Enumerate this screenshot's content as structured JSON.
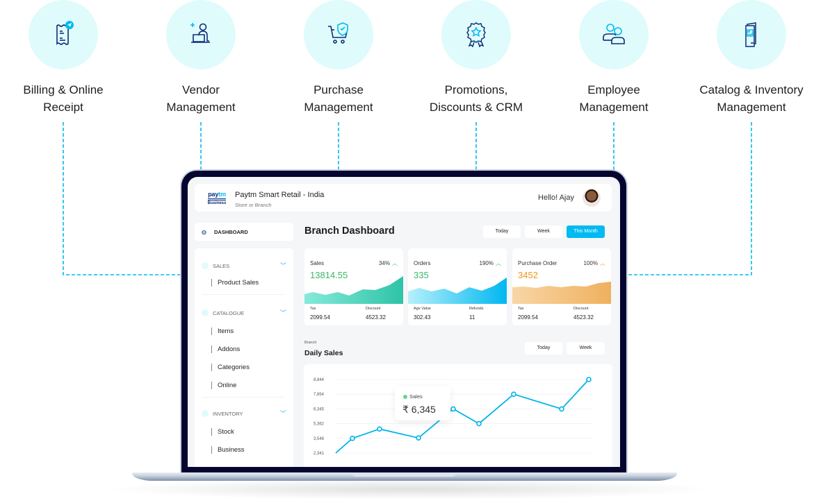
{
  "features": [
    {
      "label_line1": "Billing & Online",
      "label_line2": "Receipt",
      "icon": "receipt-send-icon"
    },
    {
      "label_line1": "Vendor",
      "label_line2": "Management",
      "icon": "person-laptop-icon"
    },
    {
      "label_line1": "Purchase",
      "label_line2": "Management",
      "icon": "cart-shield-icon"
    },
    {
      "label_line1": "Promotions,",
      "label_line2": "Discounts & CRM",
      "icon": "award-badge-icon"
    },
    {
      "label_line1": "Employee",
      "label_line2": "Management",
      "icon": "users-icon"
    },
    {
      "label_line1": "Catalog & Inventory",
      "label_line2": "Management",
      "icon": "brochure-icon"
    }
  ],
  "colors": {
    "accent": "#00baf2",
    "icon_bg": "#e0fbfc",
    "navy": "#0b2d77",
    "green": "#3bb86a",
    "orange": "#f0961e",
    "laptop_frame": "#050530"
  },
  "app": {
    "logo_line1a": "pay",
    "logo_line1b": "tm",
    "logo_line2": "for",
    "logo_line3": "Business",
    "title": "Paytm Smart Retail - India",
    "subtitle": "Store  or Branch",
    "greeting": "Hello! Ajay"
  },
  "sidebar": {
    "dashboard_label": "DASHBOARD",
    "sections": [
      {
        "title": "SALES",
        "items": [
          "Product Sales"
        ]
      },
      {
        "title": "CATALOGUE",
        "items": [
          "Items",
          "Addons",
          "Categories",
          "Online"
        ]
      },
      {
        "title": "INVENTORY",
        "items": [
          "Stock",
          "Business"
        ]
      }
    ]
  },
  "main": {
    "title": "Branch Dashboard",
    "range_buttons": [
      "Today",
      "Week",
      "This Month"
    ],
    "active_range": "This Month",
    "stats": [
      {
        "name": "Sales",
        "percent": "34%",
        "trend": "up",
        "value": "13814.55",
        "k1": "Tax",
        "v1": "2099.54",
        "k2": "Discount",
        "v2": "4523.32"
      },
      {
        "name": "Orders",
        "percent": "190%",
        "trend": "up",
        "value": "335",
        "k1": "Age Value",
        "v1": "302.43",
        "k2": "Refunds",
        "v2": "11"
      },
      {
        "name": "Purchase Order",
        "percent": "100%",
        "trend": "up",
        "value": "3452",
        "k1": "Tax",
        "v1": "2099.54",
        "k2": "Discount",
        "v2": "4523.32"
      }
    ],
    "daily": {
      "caption": "Branch",
      "title": "Daily Sales",
      "buttons": [
        "Today",
        "Week"
      ],
      "tooltip_label": "Sales",
      "tooltip_value": "₹ 6,345"
    }
  },
  "chart_data": {
    "type": "line",
    "title": "Daily Sales",
    "series": [
      {
        "name": "Sales",
        "values": [
          2341,
          3548,
          4700,
          3600,
          6345,
          5362,
          7854,
          6345,
          8844
        ]
      }
    ],
    "y_ticks": [
      "2,341",
      "3,548",
      "5,362",
      "6,345",
      "7,854",
      "8,844"
    ],
    "ylim": [
      2341,
      8844
    ],
    "grid": true,
    "tooltip": {
      "series": "Sales",
      "value": "₹ 6,345"
    }
  }
}
